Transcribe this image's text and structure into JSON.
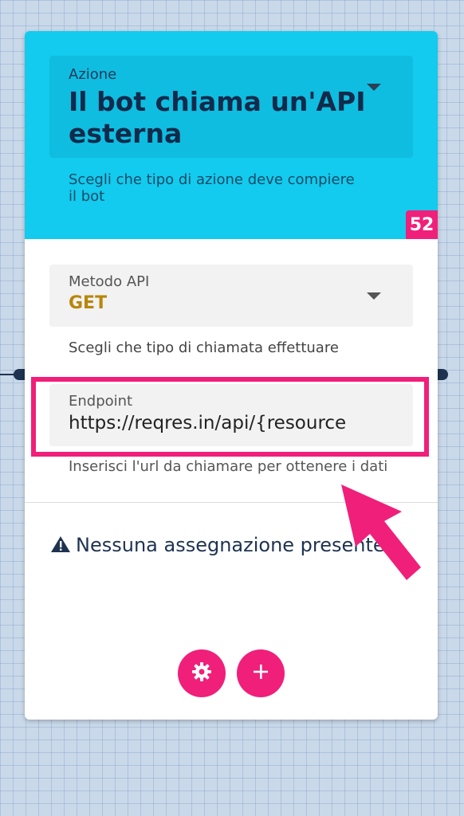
{
  "action": {
    "label": "Azione",
    "value": "Il bot chiama un'API esterna",
    "help": "Scegli che tipo di azione deve compiere il bot"
  },
  "badge": "52",
  "method": {
    "label": "Metodo API",
    "value": "GET",
    "help": "Scegli che tipo di chiamata effettuare"
  },
  "endpoint": {
    "label": "Endpoint",
    "value": "https://reqres.in/api/{resource",
    "help": "Inserisci l'url da chiamare per ottenere i dati"
  },
  "warning": {
    "icon": "warning-icon",
    "text": "Nessuna assegnazione presente"
  },
  "buttons": {
    "settings_icon": "gear-icon",
    "add_icon": "plus-icon"
  },
  "colors": {
    "header_bg": "#12cbee",
    "accent": "#f01f7a",
    "method_value": "#b8860b",
    "text_dark": "#122a4b"
  }
}
